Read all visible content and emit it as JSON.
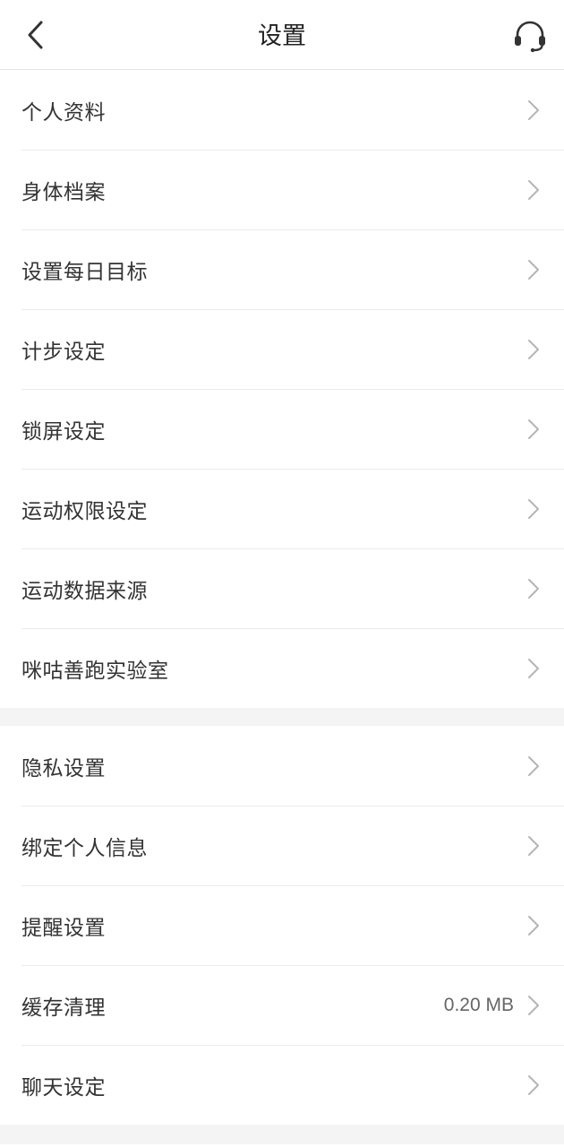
{
  "header": {
    "title": "设置",
    "back_icon": "chevron-left-icon",
    "support_icon": "headset-icon"
  },
  "groups": [
    {
      "items": [
        {
          "label": "个人资料"
        },
        {
          "label": "身体档案"
        },
        {
          "label": "设置每日目标"
        },
        {
          "label": "计步设定"
        },
        {
          "label": "锁屏设定"
        },
        {
          "label": "运动权限设定"
        },
        {
          "label": "运动数据来源"
        },
        {
          "label": "咪咕善跑实验室"
        }
      ]
    },
    {
      "items": [
        {
          "label": "隐私设置"
        },
        {
          "label": "绑定个人信息"
        },
        {
          "label": "提醒设置"
        },
        {
          "label": "缓存清理",
          "value": "0.20 MB"
        },
        {
          "label": "聊天设定"
        }
      ]
    }
  ],
  "colors": {
    "background": "#ffffff",
    "separator_band": "#f4f4f4",
    "text_primary": "#333333",
    "chevron": "#b5b5b5"
  }
}
